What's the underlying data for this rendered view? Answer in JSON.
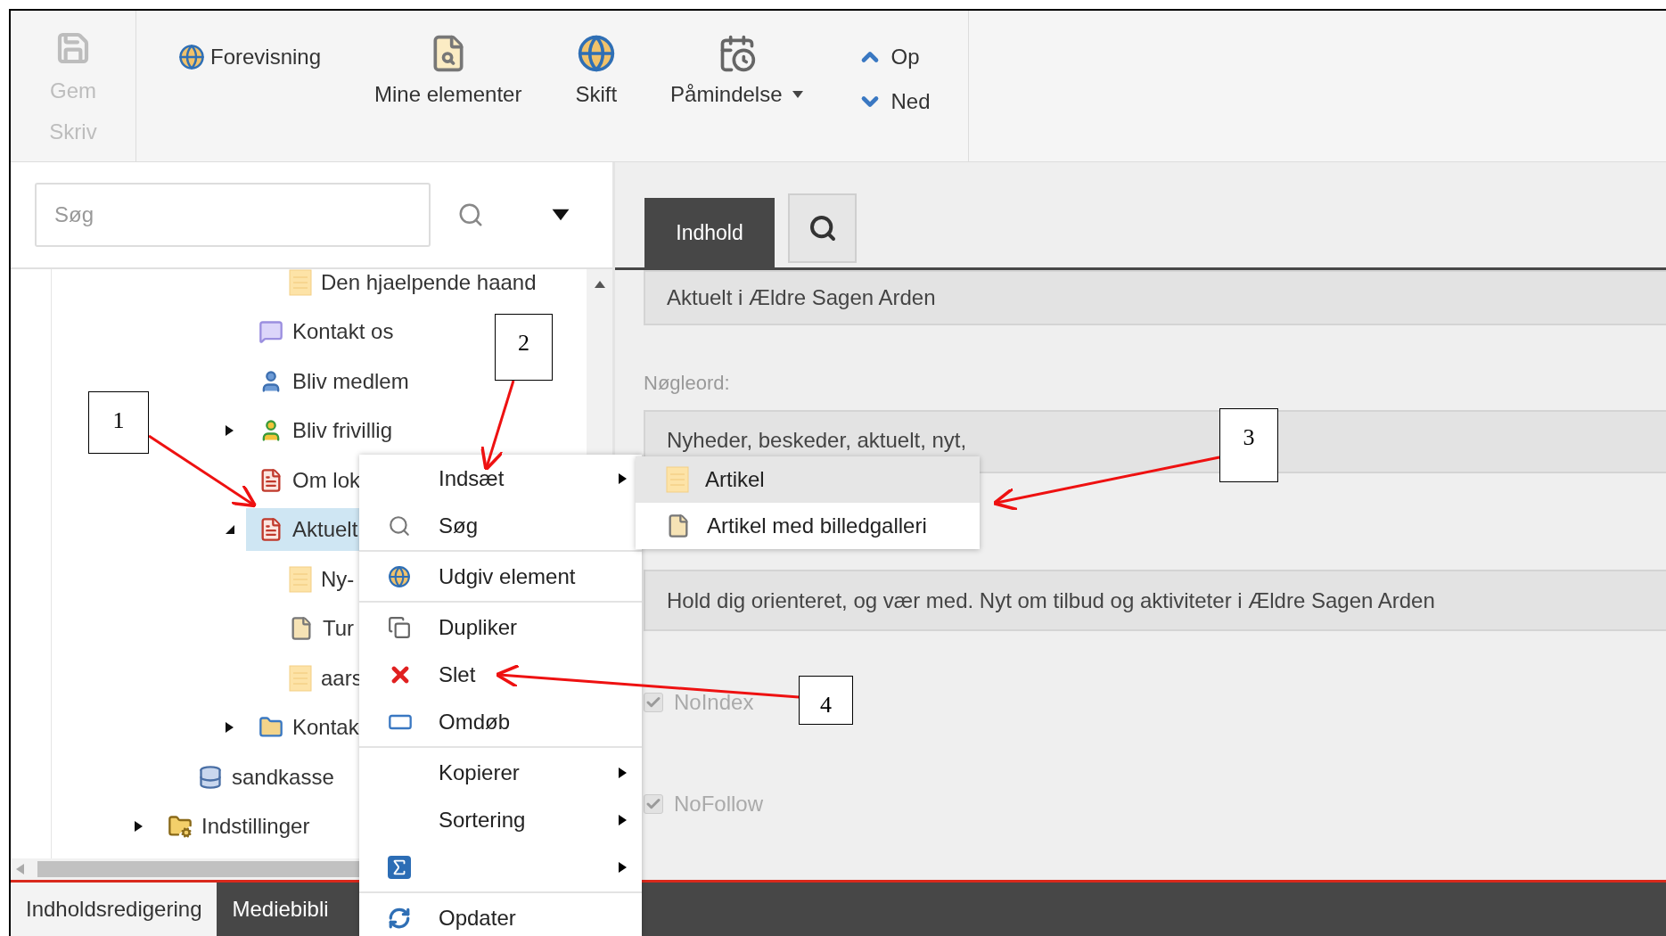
{
  "ribbon": {
    "save": {
      "label": "Gem",
      "disabled": true
    },
    "group_label": "Skriv",
    "items": [
      {
        "kind": "small",
        "label": "Forevisning"
      },
      {
        "kind": "large",
        "label": "Mine elementer"
      },
      {
        "kind": "large",
        "label": "Skift"
      },
      {
        "kind": "dropdown",
        "label": "Påmindelse"
      },
      {
        "kind": "stack",
        "items": [
          {
            "label": "Op"
          },
          {
            "label": "Ned"
          }
        ]
      }
    ]
  },
  "search": {
    "placeholder": "Søg"
  },
  "tree": [
    {
      "children": [
        {
          "children": [
            {
              "children": [
                {
                  "children": [
                    {
                      "label": "Den hjaelpende haand",
                      "selected": false
                    }
                  ]
                },
                {
                  "label": "Kontakt os",
                  "selected": false
                },
                {
                  "label": "Bliv medlem",
                  "selected": false
                },
                {
                  "label": "Bliv frivillig",
                  "expanded": false,
                  "selected": false
                },
                {
                  "label": "Om lok",
                  "selected": false
                },
                {
                  "label": "Aktuelt",
                  "expanded": true,
                  "selected": true,
                  "children": [
                    {
                      "label": "Ny-",
                      "selected": false
                    },
                    {
                      "label": "Tur",
                      "selected": false
                    },
                    {
                      "label": "aars",
                      "selected": false
                    }
                  ]
                },
                {
                  "label": "Kontak",
                  "expanded": false,
                  "selected": false
                }
              ]
            }
          ]
        },
        {
          "label": "sandkasse",
          "selected": false
        }
      ]
    },
    {
      "label": "Indstillinger",
      "expanded": false,
      "selected": false
    }
  ],
  "context_menu": {
    "items": [
      {
        "kind": "item",
        "label": "Indsæt",
        "submenu": true
      },
      {
        "kind": "item",
        "label": "Søg",
        "submenu": false
      },
      {
        "kind": "divider"
      },
      {
        "kind": "item",
        "label": "Udgiv element",
        "submenu": false
      },
      {
        "kind": "divider"
      },
      {
        "kind": "item",
        "label": "Dupliker",
        "submenu": false
      },
      {
        "kind": "item",
        "label": "Slet",
        "submenu": false
      },
      {
        "kind": "item",
        "label": "Omdøb",
        "submenu": false
      },
      {
        "kind": "divider"
      },
      {
        "kind": "item",
        "label": "Kopierer",
        "submenu": true
      },
      {
        "kind": "item",
        "label": "Sortering",
        "submenu": true
      },
      {
        "kind": "item",
        "submenu": true
      },
      {
        "kind": "divider"
      },
      {
        "kind": "item",
        "label": "Opdater",
        "submenu": false
      }
    ]
  },
  "submenu": {
    "items": [
      {
        "label": "Artikel",
        "selected": true
      },
      {
        "label": "Artikel med billedgalleri",
        "selected": false
      }
    ]
  },
  "editor": {
    "tabs": [
      {
        "kind": "text",
        "label": "Indhold",
        "selected": true
      },
      {
        "kind": "icon",
        "selected": false
      }
    ],
    "title_field": {
      "value": "Aktuelt i Ældre Sagen Arden"
    },
    "keywords": {
      "label": "Nøgleord:",
      "value": "Nyheder, beskeder, aktuelt, nyt,"
    },
    "description": {
      "value": "Hold dig orienteret, og vær med. Nyt om tilbud og aktiviteter i Ældre Sagen Arden"
    },
    "checkboxes": [
      {
        "label": "NoIndex",
        "checked": true,
        "disabled": true
      },
      {
        "label": "NoFollow",
        "checked": true,
        "disabled": true
      }
    ]
  },
  "bottom_tabs": [
    {
      "label": "Indholdsredigering",
      "selected": true
    },
    {
      "label": "Mediebibli",
      "selected": false
    }
  ],
  "annotations": [
    {
      "label": "1"
    },
    {
      "label": "2"
    },
    {
      "label": "3"
    },
    {
      "label": "4"
    }
  ]
}
